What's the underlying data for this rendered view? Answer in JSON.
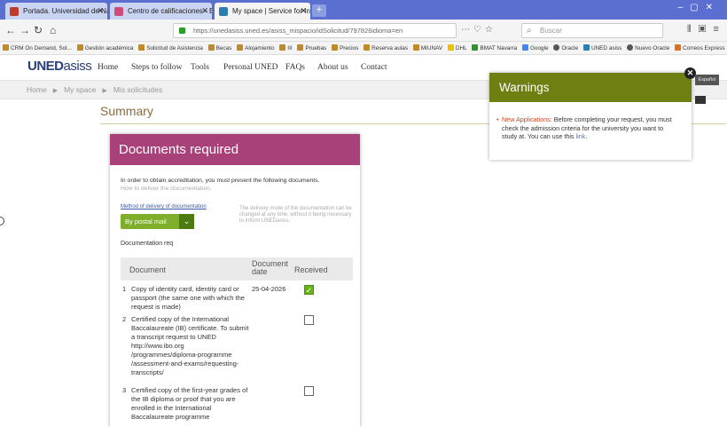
{
  "browser": {
    "tabs": [
      {
        "label": "Portada. Universidad de Navar"
      },
      {
        "label": "Centro de calificaciones - Estr"
      },
      {
        "label": "My space | Service for Internat"
      }
    ],
    "url": "https://unedasiss.uned.es/asiss_mispacio/idSolicitud/797826idioma=en",
    "search_placeholder": "Buscar",
    "bookmarks": [
      "CRM On Demand, Sol...",
      "Gestión académica",
      "Solicitud de Asistencia",
      "Becas",
      "Alojamiento",
      "III",
      "Pruebas",
      "Precios",
      "Reserva aulas",
      "MIUNAV",
      "DHL",
      "BMAT Navarra",
      "Google",
      "Oracle",
      "UNED asiss",
      "Nuevo Oracle",
      "Correos Express"
    ]
  },
  "site": {
    "logo_uned": "UNED",
    "logo_asiss": "asiss",
    "menu": [
      "Home",
      "Steps to follow",
      "Tools",
      "Personal UNED",
      "FAQs",
      "About us",
      "Contact"
    ]
  },
  "breadcrumb": [
    "Home",
    "My space",
    "Mis solicitudes"
  ],
  "summary_title": "Summary",
  "documents": {
    "title": "Documents required",
    "intro": "In order to obtain accreditation, you must present the following documents.",
    "how_link": "How to deliver the documentation.",
    "method_label": "Method of delivery of documentation",
    "method_value": "By postal mail",
    "method_note": "The delivery mode of the documentation can be changed at any time, without it being necessary to inform UNEDasiss.",
    "doc_req_label": "Documentation req",
    "columns": {
      "document": "Document",
      "date": "Document date",
      "received": "Received"
    },
    "rows": [
      {
        "num": "1",
        "text": "Copy of identity card, identity card or passport (the same one with which the request is made)",
        "date": "25-04-2026",
        "received": true
      },
      {
        "num": "2",
        "text": "Certified copy of the International Baccalaureate (IB) certificate. To submit a transcript request to UNED http://www.ibo.org /programmes/diploma-programme /assessment-and-exams/requesting-transcripts/",
        "date": "",
        "received": false
      },
      {
        "num": "3",
        "text": "Certified copy of the first-year grades of the IB diploma or proof that you are enrolled in the International Baccalaureate programme",
        "date": "",
        "received": false
      }
    ]
  },
  "warnings": {
    "title": "Warnings",
    "highlight": "New Applications:",
    "text": " Before completing your request, you must check the admission criteria for the university you want to study at. You can use this ",
    "link": "link",
    "end": "."
  },
  "language": "Español",
  "colors": {
    "doc_header": "#a8407a",
    "warn_header": "#6f7f12",
    "accent_green": "#7fae2a",
    "logo": "#2a3f7a"
  }
}
